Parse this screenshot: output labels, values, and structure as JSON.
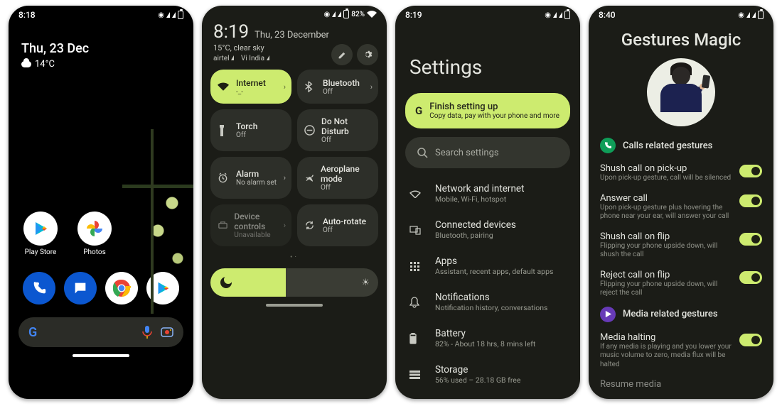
{
  "phone1": {
    "status_time": "8:18",
    "battery_icon": true,
    "widget": {
      "date": "Thu, 23 Dec",
      "temp": "14°C"
    },
    "apps": [
      {
        "name": "Play Store"
      },
      {
        "name": "Photos"
      }
    ],
    "dock": [
      "Phone",
      "Messages",
      "Chrome",
      "Play Store"
    ]
  },
  "phone2": {
    "status_battery": "82%",
    "header": {
      "time": "8:19",
      "date": "Thu, 23 December",
      "weather": "15°C, clear sky",
      "carriers": [
        "airtel",
        "Vi India"
      ]
    },
    "tiles": [
      {
        "icon": "wifi",
        "title": "Internet",
        "sub": "-_-",
        "active": true,
        "chev": true
      },
      {
        "icon": "bluetooth",
        "title": "Bluetooth",
        "sub": "Off",
        "active": false,
        "chev": true
      },
      {
        "icon": "torch",
        "title": "Torch",
        "sub": "Off",
        "active": false,
        "chev": false
      },
      {
        "icon": "dnd",
        "title": "Do Not Disturb",
        "sub": "Off",
        "active": false,
        "chev": false
      },
      {
        "icon": "alarm",
        "title": "Alarm",
        "sub": "No alarm set",
        "active": false,
        "chev": true
      },
      {
        "icon": "airplane",
        "title": "Aeroplane mode",
        "sub": "Off",
        "active": false,
        "chev": false
      },
      {
        "icon": "device",
        "title": "Device controls",
        "sub": "Unavailable",
        "active": false,
        "chev": true,
        "disabled": true
      },
      {
        "icon": "rotate",
        "title": "Auto-rotate",
        "sub": "Off",
        "active": false,
        "chev": false
      }
    ],
    "brightness_pct": 45
  },
  "phone3": {
    "status_time": "8:19",
    "title": "Settings",
    "banner": {
      "title": "Finish setting up",
      "sub": "Copy data, pay with your phone and more"
    },
    "search_placeholder": "Search settings",
    "items": [
      {
        "icon": "wifi",
        "title": "Network and internet",
        "sub": "Mobile, Wi-Fi, hotspot"
      },
      {
        "icon": "devices",
        "title": "Connected devices",
        "sub": "Bluetooth, pairing"
      },
      {
        "icon": "apps",
        "title": "Apps",
        "sub": "Assistant, recent apps, default apps"
      },
      {
        "icon": "bell",
        "title": "Notifications",
        "sub": "Notification history, conversations"
      },
      {
        "icon": "battery",
        "title": "Battery",
        "sub": "82% - About 18 hrs, 8 mins left"
      },
      {
        "icon": "storage",
        "title": "Storage",
        "sub": "56% used – 28.18 GB free"
      }
    ]
  },
  "phone4": {
    "status_time": "8:40",
    "title": "Gestures Magic",
    "section_calls": "Calls related gestures",
    "section_media": "Media related gestures",
    "opts": [
      {
        "title": "Shush call on pick-up",
        "sub": "Upon pick-up gesture, call will be silenced",
        "on": true
      },
      {
        "title": "Answer call",
        "sub": "Upon pick-up gesture plus hovering the phone near your ear, will answer your call",
        "on": true
      },
      {
        "title": "Shush call on flip",
        "sub": "Flipping your phone upside down, will shush the call",
        "on": true
      },
      {
        "title": "Reject call on flip",
        "sub": "Flipping your phone upside down, will reject the call",
        "on": true
      }
    ],
    "media_opts": [
      {
        "title": "Media halting",
        "sub": "If any media is playing and you lower your music volume to zero, media flux will be halted",
        "on": true
      },
      {
        "title": "Resume media",
        "sub": "",
        "on": true
      }
    ]
  }
}
